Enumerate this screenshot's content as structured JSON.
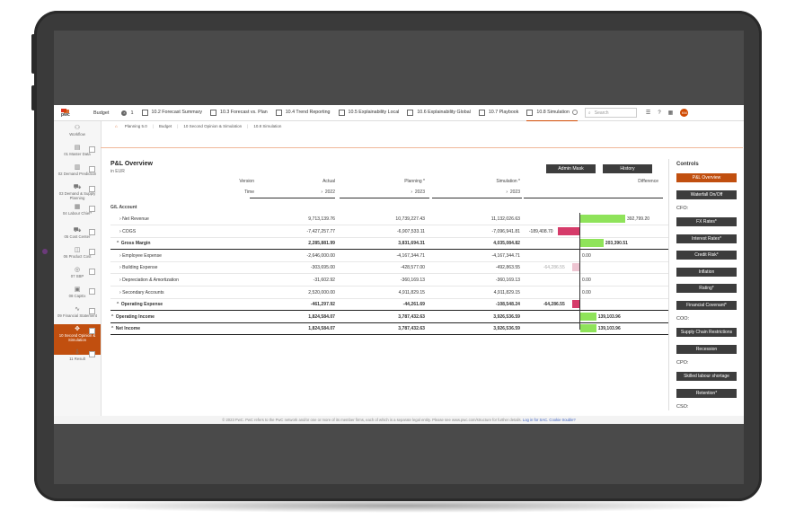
{
  "topbar": {
    "logo_text": "pwc",
    "app_name": "Budget",
    "count": "1",
    "tabs": [
      {
        "label": "10.2 Forecast Summary",
        "active": false
      },
      {
        "label": "10.3 Forecast vs. Plan",
        "active": false
      },
      {
        "label": "10.4 Trend Reporting",
        "active": false
      },
      {
        "label": "10.5 Explainability Local",
        "active": false
      },
      {
        "label": "10.6 Explainability Global",
        "active": false
      },
      {
        "label": "10.7 Playbook",
        "active": false
      },
      {
        "label": "10.8 Simulation",
        "active": true
      }
    ],
    "search_placeholder": "Search",
    "avatar_initials": "KM"
  },
  "leftnav": [
    {
      "label": "Workflow",
      "icon": "hierarchy-icon"
    },
    {
      "label": "01 Master Data",
      "icon": "data-icon"
    },
    {
      "label": "02 Demand Prediction",
      "icon": "chart-icon"
    },
    {
      "label": "03 Demand & Supply Planning",
      "icon": "cart-icon"
    },
    {
      "label": "04 Labour Chief*",
      "icon": "building-icon"
    },
    {
      "label": "05 Cost Center",
      "icon": "truck-icon"
    },
    {
      "label": "06 Product Cost",
      "icon": "box-icon"
    },
    {
      "label": "07 SBP",
      "icon": "coin-icon"
    },
    {
      "label": "08 CapEx",
      "icon": "document-icon"
    },
    {
      "label": "09 Financial Statement",
      "icon": "line-chart-icon"
    },
    {
      "label": "10 Second Opinion & Simulation",
      "icon": "move-icon",
      "active": true
    },
    {
      "label": "11 Result",
      "icon": "download-icon"
    }
  ],
  "breadcrumb": [
    "Planning 5.0",
    "Budget",
    "10 Second Opinion & Simulation",
    "10.8 Simulation"
  ],
  "panel": {
    "title": "P&L Overview",
    "subtitle": "in EUR",
    "admin_button": "Admin Mask",
    "history_button": "History",
    "header_version_label": "Version",
    "header_time_label": "Time",
    "columns": [
      {
        "version": "Actual",
        "time": "2022"
      },
      {
        "version": "Planning *",
        "time": "2023"
      },
      {
        "version": "Simulation *",
        "time": "2023"
      }
    ],
    "difference_label": "Difference",
    "section_label": "G/L Account",
    "rows": [
      {
        "label": "Net Revenue",
        "expander": ">",
        "actual": "9,713,139.76",
        "planning": "10,739,227.43",
        "simulation": "11,132,026.63",
        "difference": "392,799.20",
        "diff_value": 392799.2,
        "bold": false,
        "indent": 1
      },
      {
        "label": "COGS",
        "expander": ">",
        "actual": "-7,427,257.77",
        "planning": "-6,907,533.11",
        "simulation": "-7,096,941.81",
        "difference": "-189,408.70",
        "diff_value": -189408.7,
        "bold": false,
        "indent": 1
      },
      {
        "label": "Gross Margin",
        "expander": "^",
        "actual": "2,285,881.99",
        "planning": "3,831,694.31",
        "simulation": "4,035,084.82",
        "difference": "203,390.51",
        "diff_value": 203390.51,
        "bold": true,
        "indent": 0
      },
      {
        "label": "Employee Expense",
        "expander": ">",
        "actual": "-2,646,000.00",
        "planning": "-4,167,344.71",
        "simulation": "-4,167,344.71",
        "difference": "0.00",
        "diff_value": 0,
        "bold": false,
        "indent": 1
      },
      {
        "label": "Building Expense",
        "expander": ">",
        "actual": "-303,695.00",
        "planning": "-428,577.00",
        "simulation": "-492,863.55",
        "difference": "-64,286.55",
        "diff_value": -64286.55,
        "bold": false,
        "indent": 1,
        "faded": true
      },
      {
        "label": "Depreciation & Amortization",
        "expander": ">",
        "actual": "-31,602.92",
        "planning": "-360,169.13",
        "simulation": "-360,169.13",
        "difference": "0.00",
        "diff_value": 0,
        "bold": false,
        "indent": 1
      },
      {
        "label": "Secondary Accounts",
        "expander": ">",
        "actual": "2,520,000.00",
        "planning": "4,911,829.15",
        "simulation": "4,911,829.15",
        "difference": "0.00",
        "diff_value": 0,
        "bold": false,
        "indent": 1
      },
      {
        "label": "Operating Expense",
        "expander": "^",
        "actual": "-461,297.92",
        "planning": "-44,261.69",
        "simulation": "-108,548.24",
        "difference": "-64,286.55",
        "diff_value": -64286.55,
        "bold": true,
        "indent": 0
      },
      {
        "label": "Operating Income",
        "expander": "^",
        "actual": "1,824,584.07",
        "planning": "3,787,432.63",
        "simulation": "3,926,536.59",
        "difference": "139,103.96",
        "diff_value": 139103.96,
        "bold": true,
        "indent": -1
      },
      {
        "label": "Net Income",
        "expander": "^",
        "actual": "1,824,584.07",
        "planning": "3,787,432.63",
        "simulation": "3,926,536.59",
        "difference": "139,103.96",
        "diff_value": 139103.96,
        "bold": true,
        "indent": -1
      }
    ]
  },
  "controls": {
    "title": "Controls",
    "items": [
      {
        "type": "button",
        "label": "P&L Overview",
        "active": true
      },
      {
        "type": "button",
        "label": "Waterfall On/Off"
      },
      {
        "type": "label",
        "label": "CFO:"
      },
      {
        "type": "button",
        "label": "FX Rates*"
      },
      {
        "type": "button",
        "label": "Interest Rates*"
      },
      {
        "type": "button",
        "label": "Credit Risk*"
      },
      {
        "type": "button",
        "label": "Inflation"
      },
      {
        "type": "button",
        "label": "Rating*"
      },
      {
        "type": "button",
        "label": "Financial Covenant*"
      },
      {
        "type": "label",
        "label": "COO:"
      },
      {
        "type": "button",
        "label": "Supply Chain Restrictions"
      },
      {
        "type": "button",
        "label": "Recession"
      },
      {
        "type": "label",
        "label": "CPO:"
      },
      {
        "type": "button",
        "label": "Skilled labour shortage"
      },
      {
        "type": "button",
        "label": "Retention*"
      },
      {
        "type": "label",
        "label": "CSO:"
      }
    ]
  },
  "colors": {
    "accent": "#c14f0f",
    "positive": "#8fe35a",
    "negative": "#d63b6a"
  },
  "footer": {
    "text": "© 2023 PwC. PwC refers to the PwC network and/or one or more of its member firms, each of which is a separate legal entity. Please see www.pwc.com/structure for further details.",
    "link": "Log in for SAC. Cookie trouble?"
  }
}
